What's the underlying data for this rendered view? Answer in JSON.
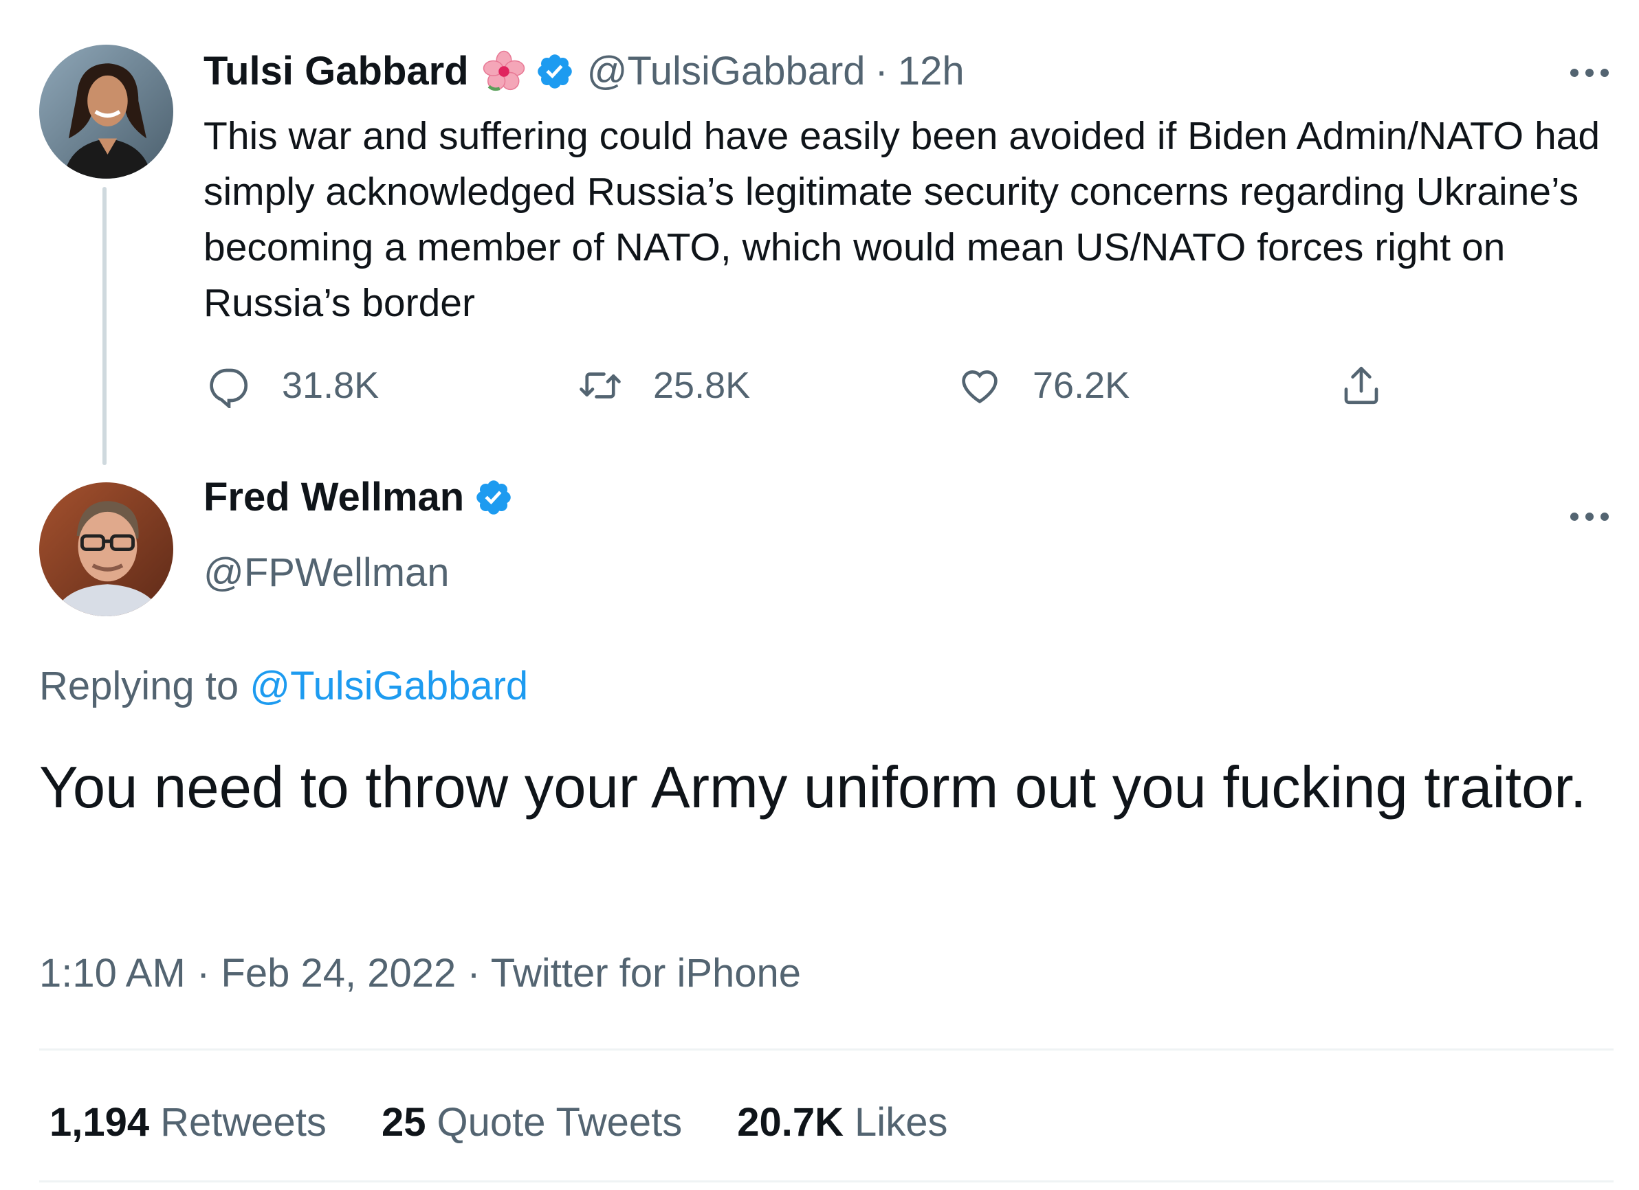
{
  "parent_tweet": {
    "display_name": "Tulsi Gabbard",
    "handle": "@TulsiGabbard",
    "separator": "·",
    "time_ago": "12h",
    "text": "This war and suffering could have easily been avoided if Biden Admin/NATO had simply acknowledged Russia’s legitimate security concerns regarding Ukraine’s becoming a member of NATO, which would mean US/NATO forces right on Russia’s border",
    "replies": "31.8K",
    "retweets": "25.8K",
    "likes": "76.2K",
    "icons": [
      "hibiscus-emoji-icon",
      "verified-icon",
      "more-icon",
      "reply-icon",
      "retweet-icon",
      "like-icon",
      "share-icon"
    ]
  },
  "reply_tweet": {
    "display_name": "Fred Wellman",
    "handle": "@FPWellman",
    "replying_label": "Replying to",
    "replying_mention": "@TulsiGabbard",
    "text": "You need to throw your Army uniform out you fucking traitor.",
    "time": "1:10 AM",
    "separator": "·",
    "date": "Feb 24, 2022",
    "client": "Twitter for iPhone"
  },
  "stats": [
    {
      "count": "1,194",
      "label": "Retweets"
    },
    {
      "count": "25",
      "label": "Quote Tweets"
    },
    {
      "count": "20.7K",
      "label": "Likes"
    }
  ],
  "colors": {
    "accent": "#1d9bf0",
    "secondary_text": "#536471",
    "primary_text": "#0f1419",
    "divider": "#eff3f4"
  }
}
